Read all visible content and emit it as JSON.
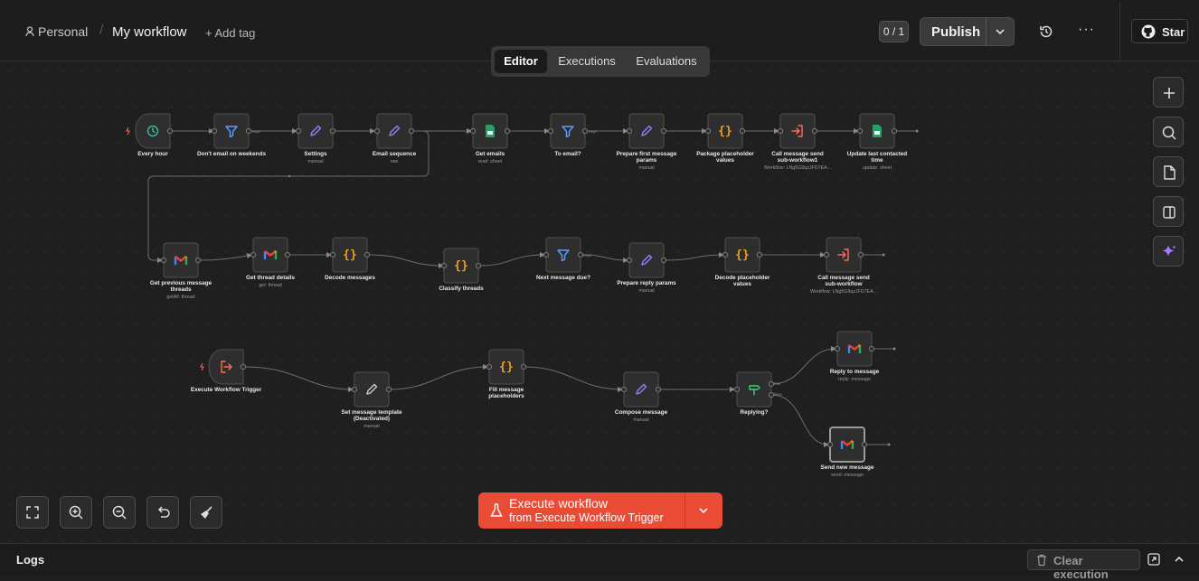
{
  "header": {
    "project": "Personal",
    "separator": "/",
    "workflow_title": "My workflow",
    "add_tag": "+ Add tag",
    "counter": "0 / 1",
    "publish_label": "Publish",
    "star_label": "Star"
  },
  "tabs": [
    {
      "label": "Editor",
      "active": true
    },
    {
      "label": "Executions",
      "active": false
    },
    {
      "label": "Evaluations",
      "active": false
    }
  ],
  "nodes": [
    {
      "id": "every_hour",
      "label": "Every hour",
      "sub": "",
      "icon": "clock-icon",
      "icon_color": "#3fb9a0"
    },
    {
      "id": "weekend",
      "label": "Don't email on weekends",
      "sub": "",
      "icon": "filter-icon",
      "icon_color": "#5aa1ff"
    },
    {
      "id": "settings",
      "label": "Settings",
      "sub": "manual",
      "icon": "pencil-icon",
      "icon_color": "#8b86ff"
    },
    {
      "id": "email_seq",
      "label": "Email sequence",
      "sub": "raw",
      "icon": "pencil-icon",
      "icon_color": "#8b86ff"
    },
    {
      "id": "get_emails",
      "label": "Get emails",
      "sub": "read: sheet",
      "icon": "sheets-icon",
      "icon_color": "#21a366"
    },
    {
      "id": "to_email",
      "label": "To email?",
      "sub": "",
      "icon": "filter-icon",
      "icon_color": "#5aa1ff"
    },
    {
      "id": "prep_first",
      "label": "Prepare first message params",
      "sub": "manual",
      "icon": "pencil-icon",
      "icon_color": "#8b86ff"
    },
    {
      "id": "package",
      "label": "Package placeholder values",
      "sub": "",
      "icon": "code-icon",
      "icon_color": "#f0a020"
    },
    {
      "id": "call_send1",
      "label": "Call message send sub-workflow1",
      "sub": "Workflow: LNg5G9qzJFD7EA...",
      "icon": "sign-in-icon",
      "icon_color": "#ff6d5a"
    },
    {
      "id": "update_last",
      "label": "Update last contacted time",
      "sub": "update: sheet",
      "icon": "sheets-icon",
      "icon_color": "#21a366"
    },
    {
      "id": "get_prev",
      "label": "Get previous message threads",
      "sub": "getAll: thread",
      "icon": "gmail-icon",
      "icon_color": "#ea4335"
    },
    {
      "id": "get_thread",
      "label": "Get thread details",
      "sub": "get: thread",
      "icon": "gmail-icon",
      "icon_color": "#ea4335"
    },
    {
      "id": "decode_msgs",
      "label": "Decode messages",
      "sub": "",
      "icon": "code-icon",
      "icon_color": "#f0a020"
    },
    {
      "id": "classify",
      "label": "Classify threads",
      "sub": "",
      "icon": "code-icon",
      "icon_color": "#f0a020"
    },
    {
      "id": "next_due",
      "label": "Next message due?",
      "sub": "",
      "icon": "filter-icon",
      "icon_color": "#5aa1ff"
    },
    {
      "id": "prep_reply",
      "label": "Prepare reply params",
      "sub": "manual",
      "icon": "pencil-icon",
      "icon_color": "#8b86ff"
    },
    {
      "id": "decode_ph",
      "label": "Decode placeholder values",
      "sub": "",
      "icon": "code-icon",
      "icon_color": "#f0a020"
    },
    {
      "id": "call_send2",
      "label": "Call message send sub-workflow",
      "sub": "Workflow: LNg5G9qzJFD7EA...",
      "icon": "sign-in-icon",
      "icon_color": "#ff6d5a"
    },
    {
      "id": "exec_trigger",
      "label": "Execute Workflow Trigger",
      "sub": "",
      "icon": "sign-out-icon",
      "icon_color": "#ff6d5a"
    },
    {
      "id": "set_template",
      "label": "Set message template (Deactivated)",
      "sub": "manual",
      "icon": "pencil-icon",
      "icon_color": "#cfcfcf"
    },
    {
      "id": "fill_ph",
      "label": "Fill message placeholders",
      "sub": "",
      "icon": "code-icon",
      "icon_color": "#f0a020"
    },
    {
      "id": "compose",
      "label": "Compose message",
      "sub": "manual",
      "icon": "pencil-icon",
      "icon_color": "#8b86ff"
    },
    {
      "id": "replying",
      "label": "Replying?",
      "sub": "",
      "icon": "signpost-icon",
      "icon_color": "#3fcf7a"
    },
    {
      "id": "reply_msg",
      "label": "Reply to message",
      "sub": "reply: message",
      "icon": "gmail-icon",
      "icon_color": "#ea4335"
    },
    {
      "id": "send_new",
      "label": "Send new message",
      "sub": "send: message",
      "icon": "gmail-icon",
      "icon_color": "#ea4335"
    }
  ],
  "port_labels": {
    "kept": "Kept",
    "true": "true",
    "false": "false"
  },
  "execute": {
    "line1": "Execute workflow",
    "line2": "from Execute Workflow Trigger"
  },
  "logs": {
    "label": "Logs",
    "clear": "Clear execution"
  },
  "colors": {
    "accent": "#ea4b34",
    "canvas": "#1f1f1f",
    "node_bg": "#2e2e2e"
  }
}
